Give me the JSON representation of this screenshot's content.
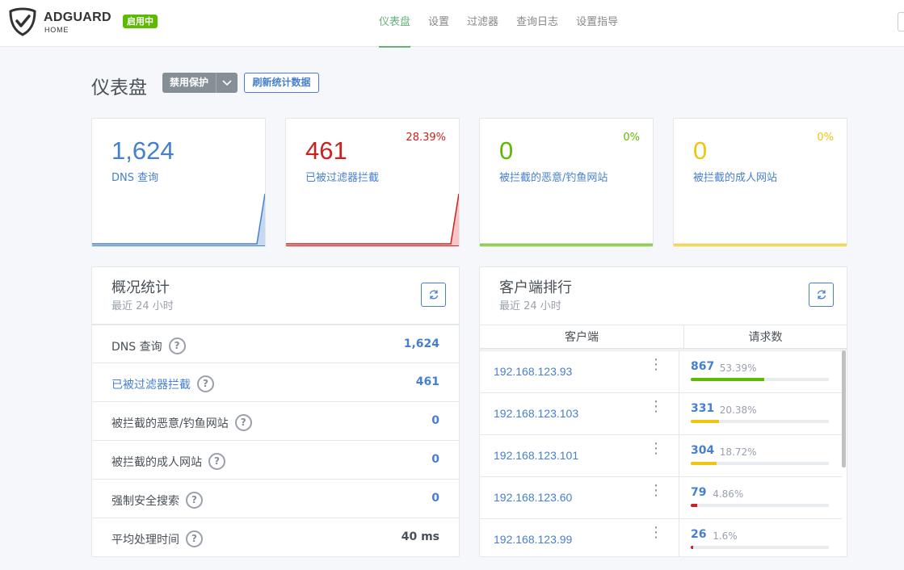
{
  "header": {
    "brand": "ADGUARD",
    "brand_sub": "HOME",
    "status": "启用中",
    "nav": [
      "仪表盘",
      "设置",
      "过滤器",
      "查询日志",
      "设置指导"
    ]
  },
  "page": {
    "title": "仪表盘",
    "disable_button": "禁用保护",
    "refresh_button": "刷新统计数据"
  },
  "stat_cards": [
    {
      "value": "1,624",
      "label": "DNS 查询",
      "percent": "",
      "color": "#467fcf",
      "fill": "#c8d8f0"
    },
    {
      "value": "461",
      "label": "已被过滤器拦截",
      "percent": "28.39%",
      "color": "#cd201f",
      "fill": "#f5c6c5"
    },
    {
      "value": "0",
      "label": "被拦截的恶意/钓鱼网站",
      "percent": "0%",
      "color": "#5eba00",
      "fill": "#d8efc0"
    },
    {
      "value": "0",
      "label": "被拦截的成人网站",
      "percent": "0%",
      "color": "#f1c40f",
      "fill": "#fbefb9"
    }
  ],
  "overview": {
    "title": "概况统计",
    "subtitle": "最近 24 小时",
    "rows": [
      {
        "label": "DNS 查询",
        "value": "1,624"
      },
      {
        "label": "已被过滤器拦截",
        "value": "461"
      },
      {
        "label": "被拦截的恶意/钓鱼网站",
        "value": "0"
      },
      {
        "label": "被拦截的成人网站",
        "value": "0"
      },
      {
        "label": "强制安全搜索",
        "value": "0"
      },
      {
        "label": "平均处理时间",
        "value": "40 ms"
      }
    ]
  },
  "clients": {
    "title": "客户端排行",
    "subtitle": "最近 24 小时",
    "col_client": "客户端",
    "col_requests": "请求数",
    "rows": [
      {
        "ip": "192.168.123.93",
        "count": "867",
        "percent": "53.39%",
        "fraction": 0.5339,
        "color": "#5eba00"
      },
      {
        "ip": "192.168.123.103",
        "count": "331",
        "percent": "20.38%",
        "fraction": 0.2038,
        "color": "#f1c40f"
      },
      {
        "ip": "192.168.123.101",
        "count": "304",
        "percent": "18.72%",
        "fraction": 0.1872,
        "color": "#f1c40f"
      },
      {
        "ip": "192.168.123.60",
        "count": "79",
        "percent": "4.86%",
        "fraction": 0.0486,
        "color": "#cd201f"
      },
      {
        "ip": "192.168.123.99",
        "count": "26",
        "percent": "1.6%",
        "fraction": 0.016,
        "color": "#cd201f"
      }
    ]
  }
}
